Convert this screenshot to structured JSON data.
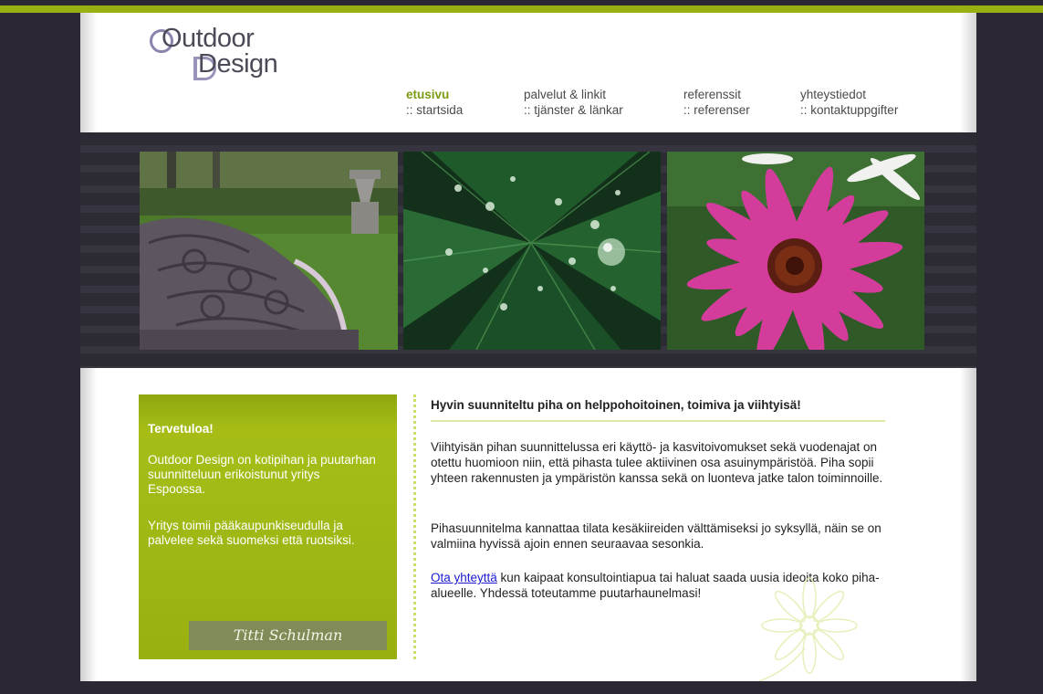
{
  "brand": {
    "line1": "Outdoor",
    "line2": "Design"
  },
  "nav": [
    {
      "fi": "etusivu",
      "sv": ":: startsida",
      "active": true
    },
    {
      "fi": "palvelut & linkit",
      "sv": ":: tjänster & länkar",
      "active": false
    },
    {
      "fi": "referenssit",
      "sv": ":: referenser",
      "active": false
    },
    {
      "fi": "yhteystiedot",
      "sv": ":: kontaktuppgifter",
      "active": false
    }
  ],
  "welcome": {
    "title": "Tervetuloa!",
    "p1": "Outdoor Design on kotipihan ja puutarhan suunnitteluun erikoistunut yritys Espoossa.",
    "p2": "Yritys toimii pääkaupunkiseudulla ja palvelee sekä suomeksi että ruotsiksi.",
    "signature": "Titti Schulman"
  },
  "main": {
    "heading": "Hyvin suunniteltu piha on helppohoitoinen, toimiva ja viihtyisä!",
    "p1": "Viihtyisän pihan suunnittelussa eri käyttö- ja kasvitoivomukset sekä vuodenajat on otettu huomioon niin, että pihasta tulee aktiivinen osa asuinympäristöä. Piha sopii yhteen rakennusten ja ympäristön kanssa sekä on luonteva jatke talon toiminnoille.",
    "p2": "Pihasuunnitelma kannattaa tilata kesäkiireiden välttämiseksi jo syksyllä, näin se on valmiina hyvissä ajoin ennen seuraavaa sesonkia.",
    "p3_link": "Ota yhteyttä",
    "p3_rest": " kun kaipaat konsultointiapua tai haluat saada uusia ideoita koko piha-alueelle. Yhdessä toteutamme puutarhaunelmasi!"
  },
  "colors": {
    "accent_green": "#9aaf12",
    "active_nav": "#7c9a12",
    "page_bg": "#2b2833",
    "link": "#1a1ad0"
  }
}
